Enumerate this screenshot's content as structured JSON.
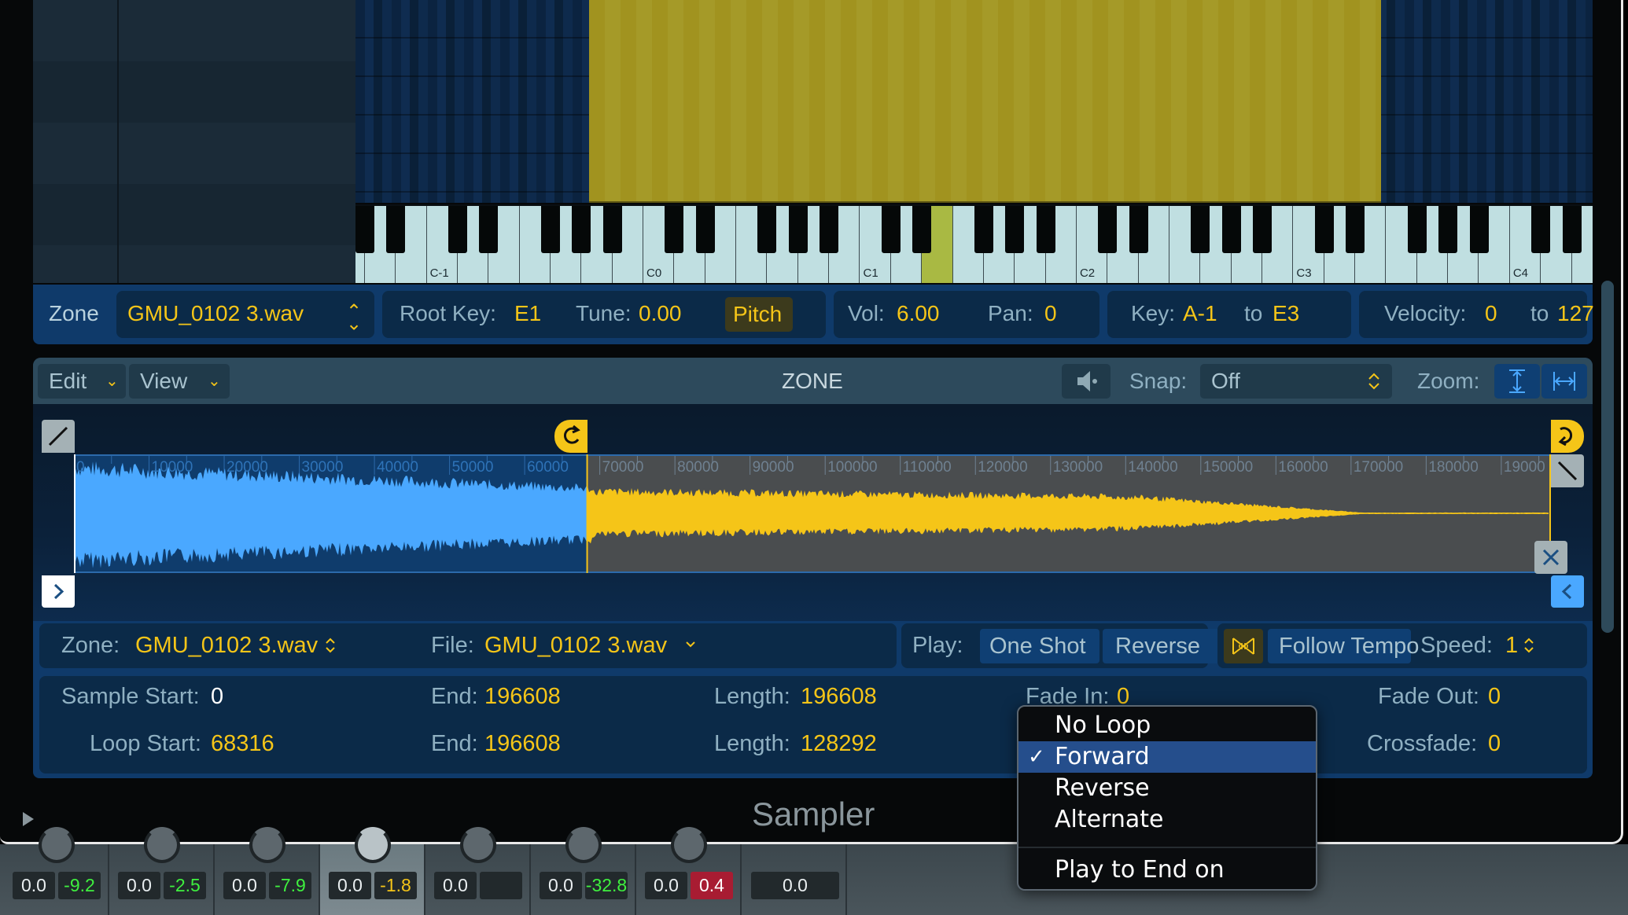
{
  "keyboard": {
    "octave_labels": [
      "C-1",
      "C0",
      "C1",
      "C2",
      "C3",
      "C4"
    ],
    "highlighted_key": "E1",
    "zone_range": {
      "from": "A-1",
      "to": "E3"
    }
  },
  "zone_bar": {
    "zone_label": "Zone",
    "zone_name": "GMU_0102 3.wav",
    "root_key_label": "Root Key:",
    "root_key": "E1",
    "tune_label": "Tune:",
    "tune": "0.00",
    "pitch_button": "Pitch",
    "vol_label": "Vol:",
    "vol": "6.00",
    "pan_label": "Pan:",
    "pan": "0",
    "key_label": "Key:",
    "key_low": "A-1",
    "key_to": "to",
    "key_high": "E3",
    "velocity_label": "Velocity:",
    "velocity_low": "0",
    "velocity_to": "to",
    "velocity_high": "127"
  },
  "zone_editor": {
    "edit_menu": "Edit",
    "view_menu": "View",
    "title": "ZONE",
    "speaker_icon": "speaker-icon",
    "snap_label": "Snap:",
    "snap_value": "Off",
    "zoom_label": "Zoom:",
    "zoom_vertical_icon": "zoom-vertical-icon",
    "zoom_horizontal_icon": "zoom-horizontal-icon",
    "ruler_ticks": [
      "0",
      "10000",
      "20000",
      "30000",
      "40000",
      "50000",
      "60000",
      "70000",
      "80000",
      "90000",
      "100000",
      "110000",
      "120000",
      "130000",
      "140000",
      "150000",
      "160000",
      "170000",
      "180000",
      "19000"
    ],
    "sample_length": 196608,
    "loop_start_marker": 68316,
    "colors": {
      "pre_loop_wave": "#4aa8ff",
      "loop_wave": "#f5c518",
      "accent": "#f5c518"
    }
  },
  "info": {
    "zone_label": "Zone:",
    "zone_value": "GMU_0102 3.wav",
    "file_label": "File:",
    "file_value": "GMU_0102 3.wav",
    "play_label": "Play:",
    "one_shot": "One Shot",
    "reverse": "Reverse",
    "follow_tempo": "Follow Tempo",
    "speed_label": "Speed:",
    "speed_value": "1",
    "sample_start_label": "Sample Start:",
    "sample_start": "0",
    "end_label": "End:",
    "sample_end": "196608",
    "length_label": "Length:",
    "sample_length": "196608",
    "fade_in_label": "Fade In:",
    "fade_in": "0",
    "fade_out_label": "Fade Out:",
    "fade_out": "0",
    "loop_start_label": "Loop Start:",
    "loop_start": "68316",
    "loop_end": "196608",
    "loop_length": "128292",
    "crossfade_label": "Crossfade:",
    "crossfade": "0"
  },
  "loop_menu": {
    "items": [
      {
        "label": "No Loop",
        "checked": false
      },
      {
        "label": "Forward",
        "checked": true
      },
      {
        "label": "Reverse",
        "checked": false
      },
      {
        "label": "Alternate",
        "checked": false
      },
      {
        "label": "Play to End on Release",
        "checked": false
      }
    ],
    "check_glyph": "✓"
  },
  "footer": {
    "plugin_name": "Sampler"
  },
  "mixer": {
    "strips": [
      {
        "gain": "0.0",
        "peak": "-9.2",
        "peak_color": "green"
      },
      {
        "gain": "0.0",
        "peak": "-2.5",
        "peak_color": "green"
      },
      {
        "gain": "0.0",
        "peak": "-7.9",
        "peak_color": "green"
      },
      {
        "gain": "0.0",
        "peak": "-1.8",
        "peak_color": "yellow"
      },
      {
        "gain": "0.0",
        "peak": "",
        "peak_color": "none"
      },
      {
        "gain": "0.0",
        "peak": "-32.8",
        "peak_color": "green"
      },
      {
        "gain": "0.0",
        "peak": "0.4",
        "peak_color": "red"
      },
      {
        "gain": "0.0",
        "peak": null,
        "peak_color": "single"
      }
    ]
  }
}
